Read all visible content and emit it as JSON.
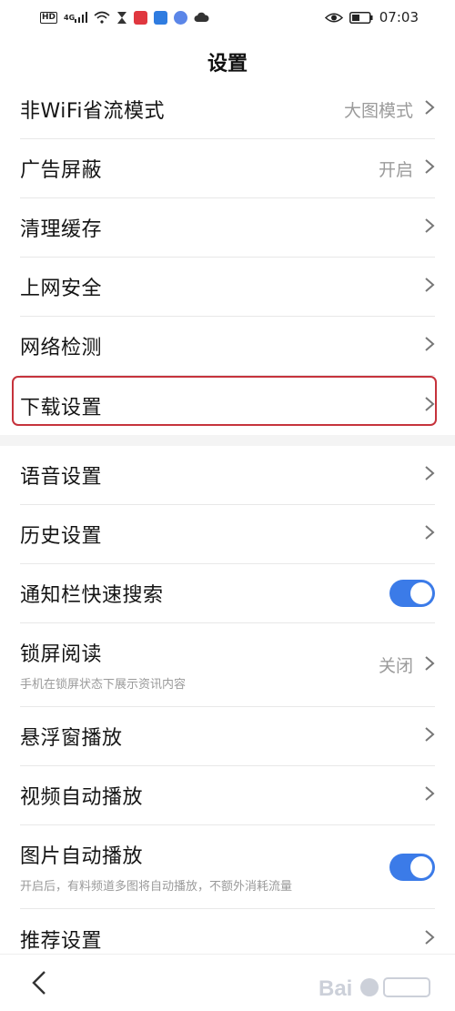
{
  "status_bar": {
    "time": "07:03",
    "hd": "HD",
    "network": "4G",
    "icons": [
      "hd-icon",
      "signal-icon",
      "wifi-icon",
      "hourglass-icon",
      "app-red-icon",
      "app-blue-icon",
      "app-music-icon",
      "cloud-icon",
      "eye-icon",
      "battery-icon"
    ]
  },
  "header": {
    "title": "设置"
  },
  "group1": [
    {
      "label": "非WiFi省流模式",
      "value": "大图模式"
    },
    {
      "label": "广告屏蔽",
      "value": "开启"
    },
    {
      "label": "清理缓存"
    },
    {
      "label": "上网安全"
    },
    {
      "label": "网络检测"
    },
    {
      "label": "下载设置",
      "highlighted": true
    }
  ],
  "group2": [
    {
      "label": "语音设置"
    },
    {
      "label": "历史设置"
    },
    {
      "label": "通知栏快速搜索",
      "toggle": true
    },
    {
      "label": "锁屏阅读",
      "sub": "手机在锁屏状态下展示资讯内容",
      "value": "关闭"
    },
    {
      "label": "悬浮窗播放"
    },
    {
      "label": "视频自动播放"
    },
    {
      "label": "图片自动播放",
      "sub": "开启后，有料频道多图将自动播放，不额外消耗流量",
      "toggle": true
    },
    {
      "label": "推荐设置"
    }
  ],
  "colors": {
    "accent": "#3b7be8",
    "highlight": "#c6333c"
  }
}
